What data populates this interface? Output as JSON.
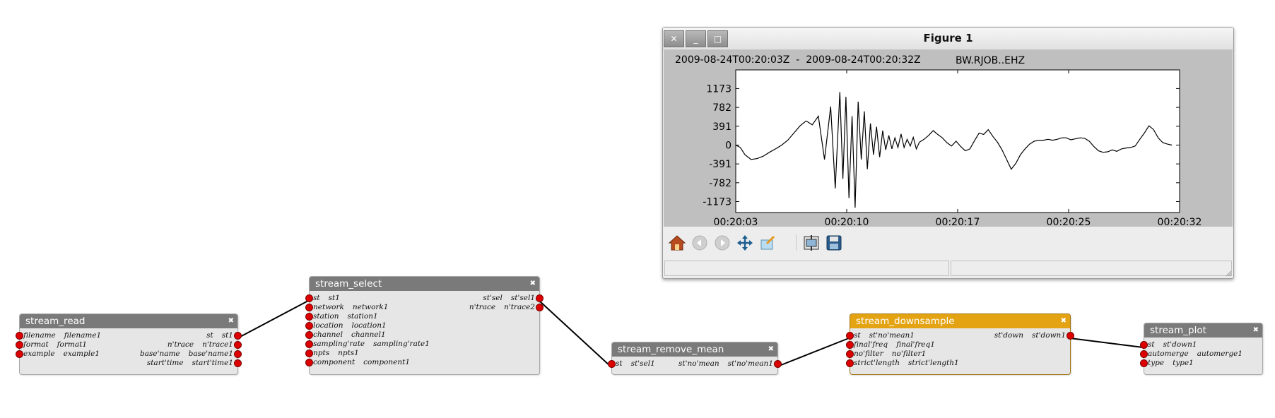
{
  "figure": {
    "title": "Figure 1",
    "time_range_label": "2009-08-24T00:20:03Z  -  2009-08-24T00:20:32Z",
    "station_label": "BW.RJOB..EHZ",
    "window_buttons": {
      "close": "✕",
      "minimize": "_",
      "maximize": "□"
    },
    "toolbar_icons": [
      "home-icon",
      "back-icon",
      "forward-icon",
      "pan-icon",
      "zoom-icon",
      "configure-subplots-icon",
      "save-icon"
    ]
  },
  "chart_data": {
    "type": "line",
    "title": "",
    "xlabel": "",
    "ylabel": "",
    "x_ticks": [
      "00:20:03",
      "00:20:10",
      "00:20:17",
      "00:20:25",
      "00:20:32"
    ],
    "y_ticks": [
      1173,
      782,
      391,
      0,
      -391,
      -782,
      -1173
    ],
    "ylim": [
      -1400,
      1560
    ],
    "xlim": [
      0,
      29
    ],
    "grid": false,
    "series": [
      {
        "values_x": [
          0,
          0.3,
          0.6,
          1,
          1.4,
          1.8,
          2.2,
          2.6,
          3,
          3.4,
          3.8,
          4.2,
          4.6,
          5,
          5.4,
          5.8,
          6.2,
          6.5,
          6.8,
          7,
          7.2,
          7.4,
          7.6,
          7.8,
          8,
          8.2,
          8.4,
          8.6,
          8.8,
          9,
          9.2,
          9.4,
          9.6,
          9.8,
          10,
          10.2,
          10.4,
          10.6,
          10.8,
          11,
          11.2,
          11.4,
          11.6,
          11.8,
          12,
          12.3,
          12.6,
          12.9,
          13.2,
          13.5,
          13.8,
          14.1,
          14.4,
          14.7,
          15,
          15.3,
          15.6,
          15.9,
          16.2,
          16.5,
          16.8,
          17.1,
          17.4,
          17.7,
          18,
          18.3,
          18.6,
          18.9,
          19.2,
          19.5,
          19.8,
          20.1,
          20.4,
          20.7,
          21,
          21.3,
          21.6,
          21.9,
          22.2,
          22.5,
          22.8,
          23.1,
          23.4,
          23.7,
          24,
          24.3,
          24.6,
          24.9,
          25.2,
          25.5,
          25.8,
          26.1,
          26.4,
          26.7,
          27,
          27.3,
          27.6,
          27.9,
          28.2,
          28.5,
          28.7,
          29
        ],
        "values_y": [
          0,
          -50,
          -200,
          -300,
          -280,
          -230,
          -150,
          -80,
          0,
          100,
          250,
          400,
          500,
          420,
          600,
          -300,
          800,
          -900,
          1100,
          -700,
          1000,
          -1100,
          600,
          -1300,
          900,
          -300,
          700,
          -500,
          450,
          -200,
          380,
          -250,
          300,
          -100,
          200,
          -80,
          150,
          -50,
          230,
          -50,
          120,
          -20,
          160,
          -80,
          60,
          120,
          200,
          300,
          220,
          150,
          50,
          -20,
          80,
          -30,
          -120,
          -80,
          90,
          250,
          220,
          320,
          180,
          60,
          -100,
          -300,
          -500,
          -380,
          -200,
          -80,
          20,
          80,
          100,
          100,
          120,
          100,
          120,
          150,
          150,
          110,
          130,
          150,
          140,
          80,
          -30,
          -120,
          -150,
          -140,
          -100,
          -130,
          -80,
          -60,
          -50,
          -20,
          120,
          250,
          400,
          320,
          150,
          50,
          20,
          0
        ]
      }
    ]
  },
  "nodes": {
    "stream_read": {
      "title": "stream_read",
      "rows": [
        {
          "in_name": "filename",
          "in_val": "filename1",
          "out_name": "st",
          "out_val": "st1"
        },
        {
          "in_name": "format",
          "in_val": "format1",
          "out_name": "n'trace",
          "out_val": "n'trace1"
        },
        {
          "in_name": "example",
          "in_val": "example1",
          "out_name": "base'name",
          "out_val": "base'name1"
        },
        {
          "in_name": "",
          "in_val": "",
          "out_name": "start'time",
          "out_val": "start'time1"
        }
      ]
    },
    "stream_select": {
      "title": "stream_select",
      "rows": [
        {
          "in_name": "st",
          "in_val": "st1",
          "out_name": "st'sel",
          "out_val": "st'sel1"
        },
        {
          "in_name": "network",
          "in_val": "network1",
          "out_name": "n'trace",
          "out_val": "n'trace2"
        },
        {
          "in_name": "station",
          "in_val": "station1",
          "out_name": "",
          "out_val": ""
        },
        {
          "in_name": "location",
          "in_val": "location1",
          "out_name": "",
          "out_val": ""
        },
        {
          "in_name": "channel",
          "in_val": "channel1",
          "out_name": "",
          "out_val": ""
        },
        {
          "in_name": "sampling'rate",
          "in_val": "sampling'rate1",
          "out_name": "",
          "out_val": ""
        },
        {
          "in_name": "npts",
          "in_val": "npts1",
          "out_name": "",
          "out_val": ""
        },
        {
          "in_name": "component",
          "in_val": "component1",
          "out_name": "",
          "out_val": ""
        }
      ]
    },
    "stream_remove_mean": {
      "title": "stream_remove_mean",
      "rows": [
        {
          "in_name": "st",
          "in_val": "st'sel1",
          "out_name": "st'no'mean",
          "out_val": "st'no'mean1"
        }
      ]
    },
    "stream_downsample": {
      "title": "stream_downsample",
      "rows": [
        {
          "in_name": "st",
          "in_val": "st'no'mean1",
          "out_name": "st'down",
          "out_val": "st'down1"
        },
        {
          "in_name": "final'freq",
          "in_val": "final'freq1",
          "out_name": "",
          "out_val": ""
        },
        {
          "in_name": "no'filter",
          "in_val": "no'filter1",
          "out_name": "",
          "out_val": ""
        },
        {
          "in_name": "strict'length",
          "in_val": "strict'length1",
          "out_name": "",
          "out_val": ""
        }
      ]
    },
    "stream_plot": {
      "title": "stream_plot",
      "rows": [
        {
          "in_name": "st",
          "in_val": "st'down1",
          "out_name": "",
          "out_val": ""
        },
        {
          "in_name": "automerge",
          "in_val": "automerge1",
          "out_name": "",
          "out_val": ""
        },
        {
          "in_name": "type",
          "in_val": "type1",
          "out_name": "",
          "out_val": ""
        }
      ]
    }
  },
  "colors": {
    "node_header": "#7a7a7a",
    "selected_header": "#e3a312",
    "port": "#dd0000",
    "wire": "#000000"
  }
}
